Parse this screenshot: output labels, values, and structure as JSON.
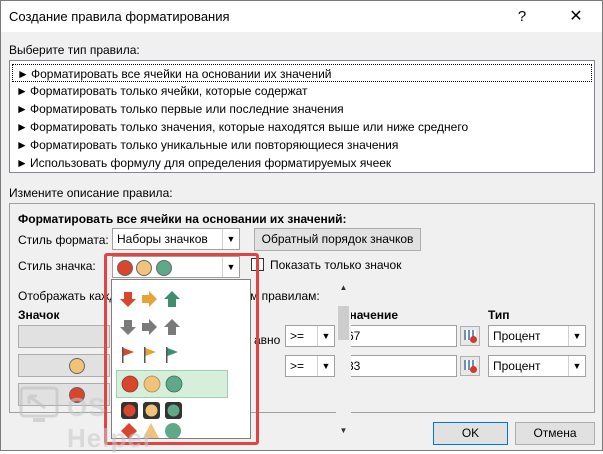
{
  "window": {
    "title": "Создание правила форматирования",
    "help": "?",
    "close": "✕"
  },
  "rule_type": {
    "label": "Выберите тип правила:",
    "items": [
      "Форматировать все ячейки на основании их значений",
      "Форматировать только ячейки, которые содержат",
      "Форматировать только первые или последние значения",
      "Форматировать только значения, которые находятся выше или ниже среднего",
      "Форматировать только уникальные или повторяющиеся значения",
      "Использовать формулу для определения форматируемых ячеек"
    ],
    "arrow": "►"
  },
  "description": {
    "label": "Измените описание правила:",
    "heading": "Форматировать все ячейки на основании их значений:",
    "format_style_label": "Стиль формата:",
    "format_style_value": "Наборы значков",
    "reverse_button": "Обратный порядок значков",
    "icon_style_label": "Стиль значка:",
    "show_icon_only_label": "Показать только значок",
    "display_label_left": "Отображать кажд",
    "display_label_right": "м правилам:",
    "col_icon": "Значок",
    "col_value": "Значение",
    "col_type": "Тип",
    "row_text": "авно",
    "rows": [
      {
        "operator": ">=",
        "value": "67",
        "type": "Процент"
      },
      {
        "operator": ">=",
        "value": "33",
        "type": "Процент"
      }
    ]
  },
  "buttons": {
    "ok": "OK",
    "cancel": "Отмена"
  },
  "watermark": "OS Helper",
  "colors": {
    "red": "#d9462f",
    "yellow": "#f0c27a",
    "green": "#5fa88a",
    "highlight": "#e04444"
  }
}
